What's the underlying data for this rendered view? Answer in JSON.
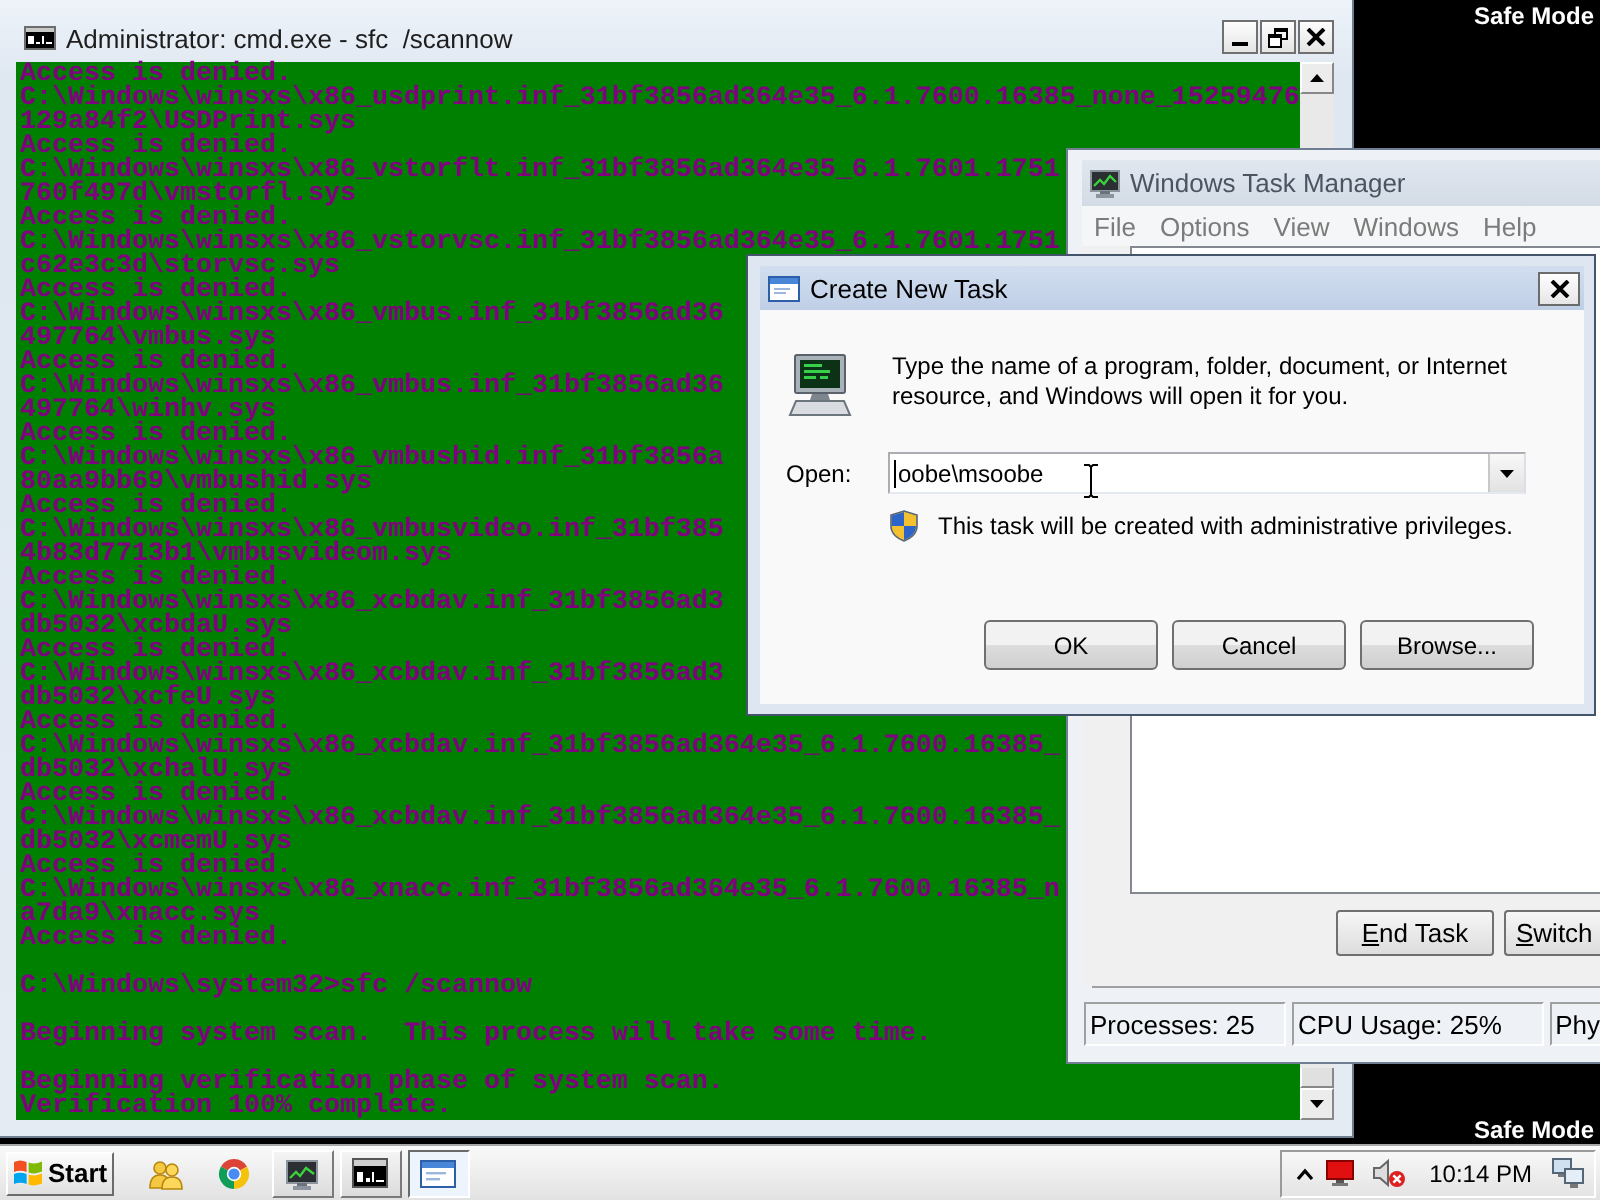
{
  "console_window": {
    "title": "Administrator: cmd.exe - sfc  /scannow",
    "blocks": [
      {
        "lines": [
          "Access is denied.",
          "C:\\Windows\\winsxs\\x86_usdprint.inf_31bf3856ad364e35_6.1.7600.16385_none_15259476",
          "129a84f2\\USDPrint.sys",
          "Access is denied.",
          "C:\\Windows\\winsxs\\x86_vstorflt.inf_31bf3856ad364e35_6.1.7601.1751",
          "760f497d\\vmstorfl.sys",
          "Access is denied.",
          "C:\\Windows\\winsxs\\x86_vstorvsc.inf_31bf3856ad364e35_6.1.7601.1751",
          "c62e3c3d\\storvsc.sys",
          "Access is denied.",
          "C:\\Windows\\winsxs\\x86_vmbus.inf_31bf3856ad36",
          "497764\\vmbus.sys",
          "Access is denied.",
          "C:\\Windows\\winsxs\\x86_vmbus.inf_31bf3856ad36",
          "497764\\winhv.sys",
          "Access is denied.",
          "C:\\Windows\\winsxs\\x86_vmbushid.inf_31bf3856a",
          "80aa9bb69\\vmbushid.sys",
          "Access is denied.",
          "C:\\Windows\\winsxs\\x86_vmbusvideo.inf_31bf385",
          "4b83d7713b1\\vmbusvideom.sys",
          "Access is denied.",
          "C:\\Windows\\winsxs\\x86_xcbdav.inf_31bf3856ad3",
          "db5032\\xcbdaU.sys",
          "Access is denied.",
          "C:\\Windows\\winsxs\\x86_xcbdav.inf_31bf3856ad3",
          "db5032\\xcfeU.sys",
          "Access is denied.",
          "C:\\Windows\\winsxs\\x86_xcbdav.inf_31bf3856ad364e35_6.1.7600.16385_",
          "db5032\\xchalU.sys",
          "Access is denied.",
          "C:\\Windows\\winsxs\\x86_xcbdav.inf_31bf3856ad364e35_6.1.7600.16385_",
          "db5032\\xcmemU.sys",
          "Access is denied.",
          "C:\\Windows\\winsxs\\x86_xnacc.inf_31bf3856ad364e35_6.1.7600.16385_n",
          "a7da9\\xnacc.sys",
          "Access is denied."
        ]
      },
      {
        "lines": [
          "C:\\Windows\\system32>sfc /scannow"
        ]
      },
      {
        "lines": [
          "Beginning system scan.  This process will take some time."
        ]
      },
      {
        "lines": [
          "Beginning verification phase of system scan.",
          "Verification 100% complete."
        ]
      }
    ]
  },
  "desktop_labels": [
    "Safe Mode",
    "Safe Mode"
  ],
  "task_manager": {
    "title": "Windows Task Manager",
    "menu": [
      "File",
      "Options",
      "View",
      "Windows",
      "Help"
    ],
    "buttons": [
      "End Task",
      "Switch"
    ],
    "status_bar": [
      "Processes: 25",
      "CPU Usage: 25%",
      "Phy"
    ]
  },
  "dialog": {
    "title": "Create New Task",
    "message": "Type the name of a program, folder, document, or Internet resource, and Windows will open it for you.",
    "open_field": {
      "label": "Open:",
      "value": "oobe\\msoobe",
      "focused": true
    },
    "note": "This task will be created with administrative privileges.",
    "buttons": [
      "OK",
      "Cancel",
      "Browse..."
    ]
  },
  "taskbar": {
    "start": "Start",
    "items": [
      {
        "kind": "people",
        "running": false,
        "selected": false
      },
      {
        "kind": "browser",
        "running": false,
        "selected": false
      },
      {
        "kind": "monitor",
        "running": true,
        "selected": false
      },
      {
        "kind": "console",
        "running": true,
        "selected": false
      },
      {
        "kind": "window",
        "running": true,
        "selected": true
      }
    ],
    "clock": "10:14 PM"
  }
}
